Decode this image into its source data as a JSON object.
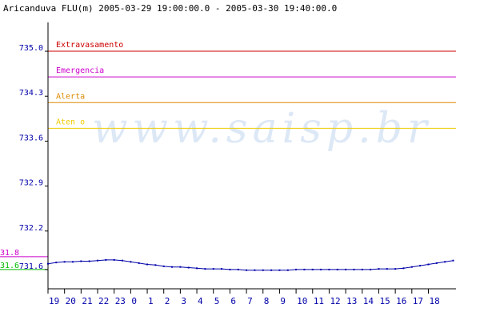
{
  "chart_data": {
    "type": "line",
    "title": "Aricanduva FLU(m) 2005-03-29 19:00:00.0 - 2005-03-30 19:40:00.0",
    "watermark": "www.saisp.br",
    "x_tick_labels": [
      "19",
      "20",
      "21",
      "22",
      "23",
      "0",
      "1",
      "2",
      "3",
      "4",
      "5",
      "6",
      "7",
      "8",
      "9",
      "10",
      "11",
      "12",
      "13",
      "14",
      "15",
      "16",
      "17",
      "18"
    ],
    "y_tick_labels": [
      "735.0",
      "734.3",
      "733.6",
      "732.9",
      "732.2",
      "731.6"
    ],
    "ylim": [
      731.3,
      735.2
    ],
    "xlim": [
      0,
      24.67
    ],
    "grid": false,
    "thresholds": [
      {
        "label": "Extravasamento",
        "value": 735.0,
        "color": "#cc0000"
      },
      {
        "label": "Emergencia",
        "value": 734.6,
        "color": "#cc00cc"
      },
      {
        "label": "Alerta",
        "value": 734.2,
        "color": "#dd8800"
      },
      {
        "label": "Aten  o",
        "value": 733.8,
        "color": "#eecc00"
      }
    ],
    "side_markers": [
      {
        "label": "31.8",
        "value": 731.8,
        "color": "#cc00cc"
      },
      {
        "label": "31.6",
        "value": 731.6,
        "color": "#00bb00"
      }
    ],
    "series": [
      {
        "color": "#0000aa",
        "x": [
          0,
          0.5,
          1,
          1.5,
          2,
          2.5,
          3,
          3.5,
          4,
          4.5,
          5,
          5.5,
          6,
          6.5,
          7,
          7.5,
          8,
          8.5,
          9,
          9.5,
          10,
          10.5,
          11,
          11.5,
          12,
          12.5,
          13,
          13.5,
          14,
          14.5,
          15,
          15.5,
          16,
          16.5,
          17,
          17.5,
          18,
          18.5,
          19,
          19.5,
          20,
          20.5,
          21,
          21.5,
          22,
          22.5,
          23,
          23.5,
          24,
          24.5
        ],
        "values": [
          731.69,
          731.71,
          731.72,
          731.72,
          731.73,
          731.73,
          731.74,
          731.75,
          731.75,
          731.74,
          731.72,
          731.7,
          731.68,
          731.67,
          731.65,
          731.64,
          731.64,
          731.63,
          731.62,
          731.61,
          731.61,
          731.61,
          731.6,
          731.6,
          731.59,
          731.59,
          731.59,
          731.59,
          731.59,
          731.59,
          731.6,
          731.6,
          731.6,
          731.6,
          731.6,
          731.6,
          731.6,
          731.6,
          731.6,
          731.6,
          731.61,
          731.61,
          731.61,
          731.62,
          731.64,
          731.66,
          731.68,
          731.7,
          731.72,
          731.74
        ]
      }
    ]
  }
}
